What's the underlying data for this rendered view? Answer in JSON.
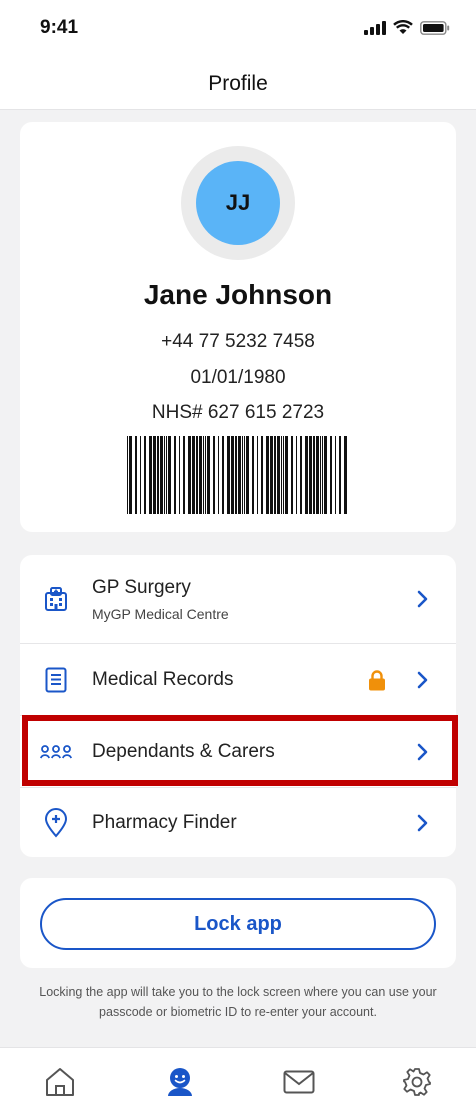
{
  "status_bar": {
    "time": "9:41",
    "icons": [
      "signal-icon",
      "wifi-icon",
      "battery-icon"
    ]
  },
  "header": {
    "title": "Profile"
  },
  "profile": {
    "initials": "JJ",
    "name": "Jane Johnson",
    "phone": "+44 77 5232 7458",
    "dob": "01/01/1980",
    "nhs_number": "NHS# 627 615 2723",
    "barcode_icon": "barcode-icon"
  },
  "menu": {
    "items": [
      {
        "label": "GP Surgery",
        "sublabel": "MyGP Medical Centre",
        "icon": "hospital-icon"
      },
      {
        "label": "Medical Records",
        "icon": "document-icon",
        "locked": true
      },
      {
        "label": "Dependants & Carers",
        "icon": "people-icon",
        "highlighted": true
      },
      {
        "label": "Pharmacy Finder",
        "icon": "location-plus-icon"
      }
    ]
  },
  "lock": {
    "button_label": "Lock app",
    "note": "Locking the app will take you to the lock screen where you can use your passcode or biometric ID to re-enter your account."
  },
  "tabbar": {
    "tabs": [
      {
        "icon": "home-icon",
        "active": false
      },
      {
        "icon": "profile-icon",
        "active": true
      },
      {
        "icon": "mail-icon",
        "active": false
      },
      {
        "icon": "settings-icon",
        "active": false
      }
    ]
  },
  "colors": {
    "accent": "#1a56c8",
    "avatar": "#5ab4f7",
    "lock_badge": "#f0900a",
    "highlight_border": "#c00000",
    "background": "#f2f2f3"
  }
}
